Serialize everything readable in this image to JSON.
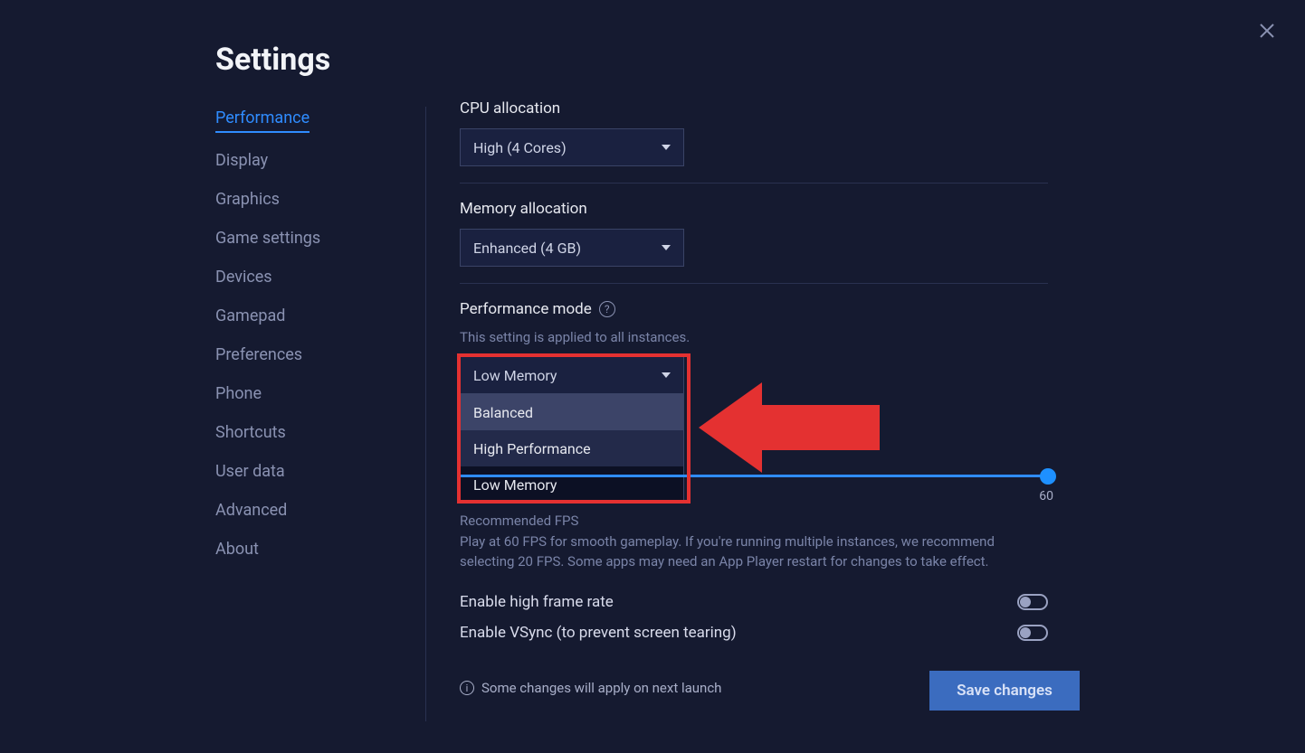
{
  "title": "Settings",
  "sidebar": {
    "items": [
      {
        "label": "Performance",
        "active": true
      },
      {
        "label": "Display"
      },
      {
        "label": "Graphics"
      },
      {
        "label": "Game settings"
      },
      {
        "label": "Devices"
      },
      {
        "label": "Gamepad"
      },
      {
        "label": "Preferences"
      },
      {
        "label": "Phone"
      },
      {
        "label": "Shortcuts"
      },
      {
        "label": "User data"
      },
      {
        "label": "Advanced"
      },
      {
        "label": "About"
      }
    ]
  },
  "cpu": {
    "label": "CPU allocation",
    "value": "High (4 Cores)"
  },
  "memory": {
    "label": "Memory allocation",
    "value": "Enhanced (4 GB)"
  },
  "perfmode": {
    "label": "Performance mode",
    "hint": "This setting is applied to all instances.",
    "value": "Low Memory",
    "options": [
      "Balanced",
      "High Performance",
      "Low Memory"
    ]
  },
  "fps": {
    "recommended_label": "Recommended FPS",
    "desc": "Play at 60 FPS for smooth gameplay. If you're running multiple instances, we recommend selecting 20 FPS. Some apps may need an App Player restart for changes to take effect.",
    "max_label": "60"
  },
  "toggles": {
    "high_frame_label": "Enable high frame rate",
    "vsync_label": "Enable VSync (to prevent screen tearing)"
  },
  "footer": {
    "note": "Some changes will apply on next launch",
    "save_label": "Save changes"
  }
}
